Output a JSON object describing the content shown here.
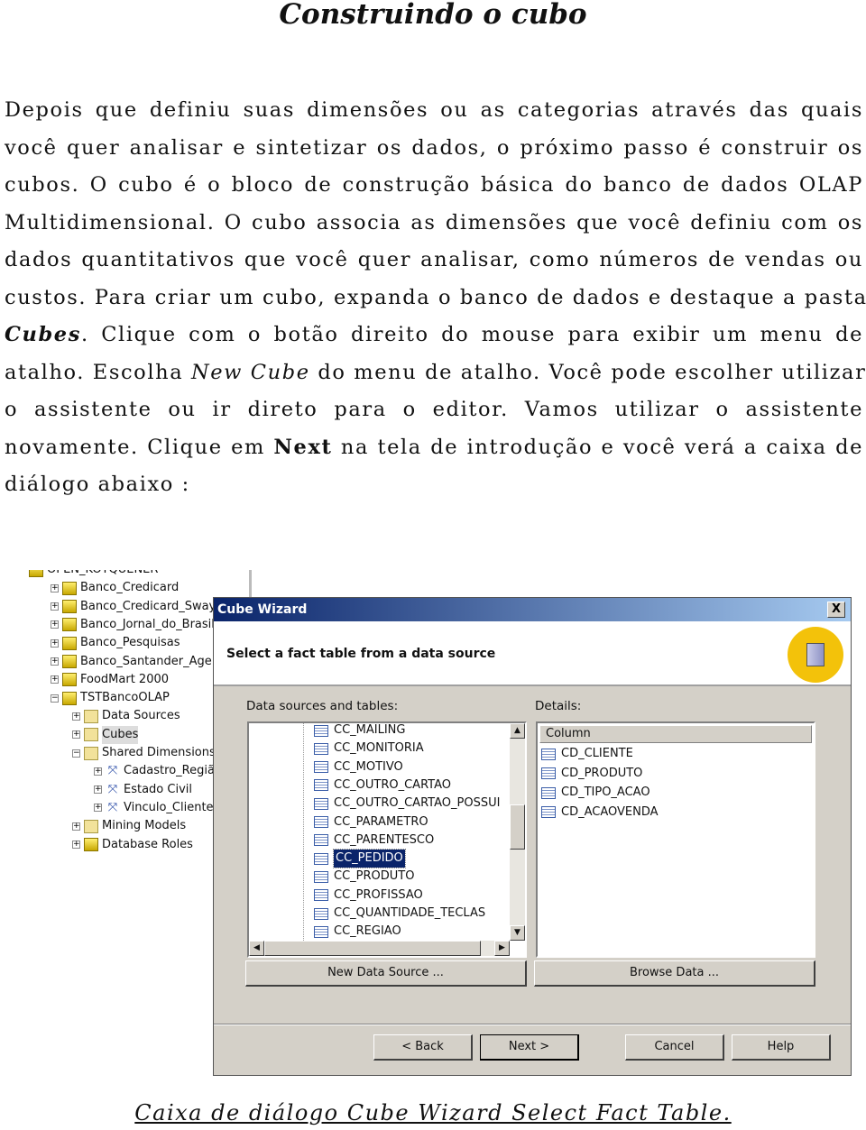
{
  "title": "Construindo o cubo",
  "paragraph": [
    [
      {
        "t": "Depois que definiu suas dimensões ou as categorias através das quais"
      }
    ],
    [
      {
        "t": "você quer analisar e sintetizar os dados, o próximo passo é construir os"
      }
    ],
    [
      {
        "t": "cubos. O cubo é o bloco de construção básica do banco de dados OLAP"
      }
    ],
    [
      {
        "t": "Multidimensional. O cubo associa as dimensões que você definiu com os"
      }
    ],
    [
      {
        "t": "dados quantitativos que você quer analisar, como números de vendas ou"
      }
    ],
    [
      {
        "t": "custos. Para criar um cubo, expanda o banco de dados e destaque a pasta"
      }
    ],
    [
      {
        "t": "Cubes",
        "s": "b i"
      },
      {
        "t": ". Clique com o botão direito do mouse para exibir um menu de"
      }
    ],
    [
      {
        "t": "atalho. Escolha "
      },
      {
        "t": "New Cube",
        "s": "i"
      },
      {
        "t": " do menu de atalho. Você pode escolher utilizar"
      }
    ],
    [
      {
        "t": "o assistente ou ir direto para o editor. Vamos utilizar o assistente"
      }
    ],
    [
      {
        "t": "novamente. Clique em "
      },
      {
        "t": "Next",
        "s": "b"
      },
      {
        "t": " na tela de  introdução e você verá a caixa de"
      }
    ],
    [
      {
        "t": "diálogo abaixo :"
      }
    ]
  ],
  "tree": {
    "items": [
      {
        "label": "OPEN_KOTQUENER",
        "type": "server",
        "level": 0
      },
      {
        "label": "Banco_Credicard",
        "type": "db",
        "level": 1,
        "expander": "+"
      },
      {
        "label": "Banco_Credicard_Sway",
        "type": "db",
        "level": 1,
        "expander": "+"
      },
      {
        "label": "Banco_Jornal_do_Brasil",
        "type": "db",
        "level": 1,
        "expander": "+"
      },
      {
        "label": "Banco_Pesquisas",
        "type": "db",
        "level": 1,
        "expander": "+"
      },
      {
        "label": "Banco_Santander_Age",
        "type": "db",
        "level": 1,
        "expander": "+"
      },
      {
        "label": "FoodMart 2000",
        "type": "db",
        "level": 1,
        "expander": "+"
      },
      {
        "label": "TSTBancoOLAP",
        "type": "db",
        "level": 1,
        "expander": "-"
      },
      {
        "label": "Data Sources",
        "type": "folder",
        "level": 2,
        "expander": "+"
      },
      {
        "label": "Cubes",
        "type": "folder",
        "level": 2,
        "expander": "+",
        "selected": true
      },
      {
        "label": "Shared Dimensions",
        "type": "folder",
        "level": 2,
        "expander": "-"
      },
      {
        "label": "Cadastro_Região",
        "type": "dim",
        "level": 3,
        "expander": "+"
      },
      {
        "label": "Estado Civil",
        "type": "dim",
        "level": 3,
        "expander": "+"
      },
      {
        "label": "Vinculo_Cliente",
        "type": "dim",
        "level": 3,
        "expander": "+"
      },
      {
        "label": "Mining Models",
        "type": "folder",
        "level": 2,
        "expander": "+"
      },
      {
        "label": "Database Roles",
        "type": "roles",
        "level": 2,
        "expander": "+"
      }
    ]
  },
  "dialog": {
    "title": "Cube Wizard",
    "close": "X",
    "header": "Select a fact table from a data source",
    "sources_label": "Data sources and tables:",
    "details_label": "Details:",
    "tables": [
      "CC_MAILING",
      "CC_MONITORIA",
      "CC_MOTIVO",
      "CC_OUTRO_CARTAO",
      "CC_OUTRO_CARTAO_POSSUI",
      "CC_PARAMETRO",
      "CC_PARENTESCO",
      "CC_PEDIDO",
      "CC_PRODUTO",
      "CC_PROFISSAO",
      "CC_QUANTIDADE_TECLAS",
      "CC_REGIAO"
    ],
    "selected_table": "CC_PEDIDO",
    "column_header": "Column",
    "columns": [
      "CD_CLIENTE",
      "CD_PRODUTO",
      "CD_TIPO_ACAO",
      "CD_ACAOVENDA"
    ],
    "new_source": "New Data Source ...",
    "browse": "Browse Data ...",
    "back": "< Back",
    "next": "Next >",
    "cancel": "Cancel",
    "help": "Help",
    "accent": "#0a246a"
  },
  "caption": "Caixa de diálogo Cube Wizard Select Fact Table."
}
